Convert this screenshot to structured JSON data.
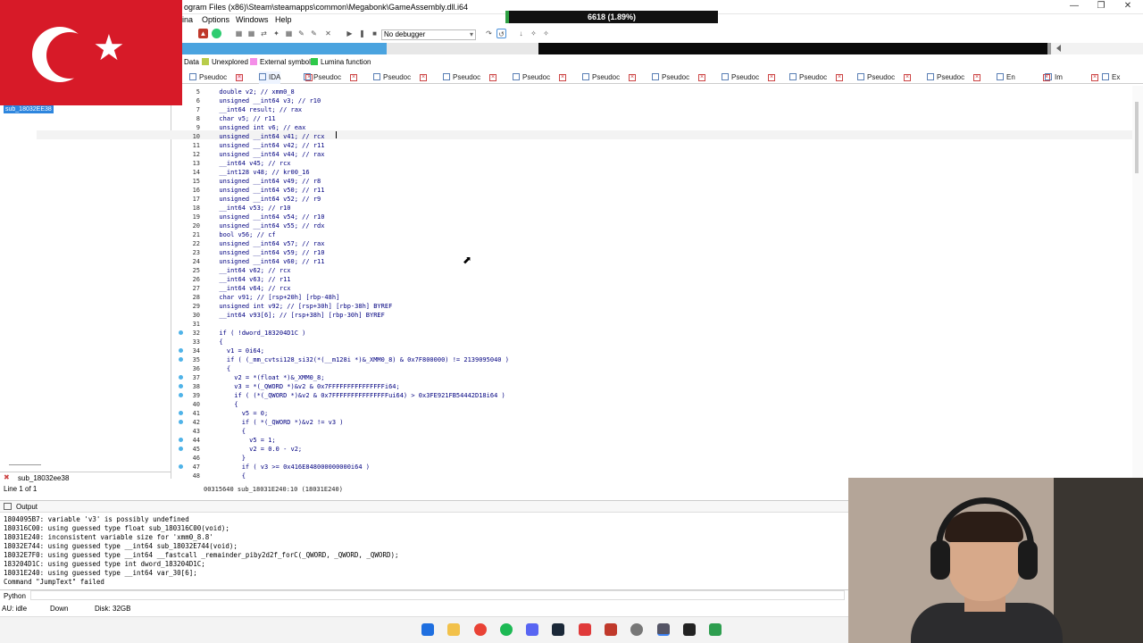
{
  "window": {
    "title": "ogram Files (x86)\\Steam\\steamapps\\common\\Megabonk\\GameAssembly.dll.i64",
    "progress_text": "6618 (1.89%)",
    "progress_fraction": 0.0189
  },
  "menu": [
    "ina",
    "Options",
    "Windows",
    "Help"
  ],
  "toolbar": {
    "debugger": "No debugger"
  },
  "legend": {
    "data": "Data",
    "unexplored": "Unexplored",
    "external": "External symbol",
    "lumina": "Lumina function",
    "colors": {
      "data": "#c8c8c8",
      "unexplored": "#b8cc4a",
      "external": "#f48ee8",
      "lumina": "#2ec94a"
    }
  },
  "tabs": [
    {
      "label": "Pseudoc",
      "close": true
    },
    {
      "label": "IDA",
      "close": false
    },
    {
      "label": "Pseudoc",
      "close": false
    },
    {
      "label": "Pseudoc",
      "close": false
    },
    {
      "label": "Pseudoc",
      "close": false
    },
    {
      "label": "Pseudoc",
      "close": false
    },
    {
      "label": "Pseudoc",
      "close": false
    },
    {
      "label": "Pseudoc",
      "close": false
    },
    {
      "label": "Pseudoc",
      "close": false
    },
    {
      "label": "Pseudoc",
      "close": false
    },
    {
      "label": "Pseudoc",
      "close": false
    },
    {
      "label": "Pseudoc",
      "close": false
    },
    {
      "label": "En",
      "close": false
    },
    {
      "label": "Im",
      "close": false
    },
    {
      "label": "Ex",
      "close": false
    }
  ],
  "functions": {
    "selected": "sub_18032EE38",
    "search_value": "sub_18032ee38",
    "line_info": "Line 1 of 1"
  },
  "code": {
    "lines": [
      {
        "n": "5",
        "t": "  double v2; // xmm0_8",
        "bp": false
      },
      {
        "n": "6",
        "t": "  unsigned __int64 v3; // r10",
        "bp": false
      },
      {
        "n": "7",
        "t": "  __int64 result; // rax",
        "bp": false
      },
      {
        "n": "8",
        "t": "  char v5; // r11",
        "bp": false
      },
      {
        "n": "9",
        "t": "  unsigned int v6; // eax",
        "bp": false
      },
      {
        "n": "10",
        "t": "  unsigned __int64 v41; // rcx",
        "bp": false
      },
      {
        "n": "11",
        "t": "  unsigned __int64 v42; // r11",
        "bp": false
      },
      {
        "n": "12",
        "t": "  unsigned __int64 v44; // rax",
        "bp": false
      },
      {
        "n": "13",
        "t": "  __int64 v45; // rcx",
        "bp": false
      },
      {
        "n": "14",
        "t": "  __int128 v48; // kr00_16",
        "bp": false
      },
      {
        "n": "15",
        "t": "  unsigned __int64 v49; // r8",
        "bp": false
      },
      {
        "n": "16",
        "t": "  unsigned __int64 v50; // r11",
        "bp": false
      },
      {
        "n": "17",
        "t": "  unsigned __int64 v52; // r9",
        "bp": false
      },
      {
        "n": "18",
        "t": "  __int64 v53; // r10",
        "bp": false
      },
      {
        "n": "19",
        "t": "  unsigned __int64 v54; // r10",
        "bp": false
      },
      {
        "n": "20",
        "t": "  unsigned __int64 v55; // rdx",
        "bp": false
      },
      {
        "n": "21",
        "t": "  bool v56; // cf",
        "bp": false
      },
      {
        "n": "22",
        "t": "  unsigned __int64 v57; // rax",
        "bp": false
      },
      {
        "n": "23",
        "t": "  unsigned __int64 v59; // r10",
        "bp": false
      },
      {
        "n": "24",
        "t": "  unsigned __int64 v60; // r11",
        "bp": false
      },
      {
        "n": "25",
        "t": "  __int64 v62; // rcx",
        "bp": false
      },
      {
        "n": "26",
        "t": "  __int64 v63; // r11",
        "bp": false
      },
      {
        "n": "27",
        "t": "  __int64 v64; // rcx",
        "bp": false
      },
      {
        "n": "28",
        "t": "  char v91; // [rsp+20h] [rbp-48h]",
        "bp": false
      },
      {
        "n": "29",
        "t": "  unsigned int v92; // [rsp+30h] [rbp-38h] BYREF",
        "bp": false
      },
      {
        "n": "30",
        "t": "  __int64 v93[6]; // [rsp+38h] [rbp-30h] BYREF",
        "bp": false
      },
      {
        "n": "31",
        "t": "",
        "bp": false
      },
      {
        "n": "32",
        "t": "  if ( !dword_183204D1C )",
        "bp": true
      },
      {
        "n": "33",
        "t": "  {",
        "bp": false
      },
      {
        "n": "34",
        "t": "    v1 = 0i64;",
        "bp": true
      },
      {
        "n": "35",
        "t": "    if ( (_mm_cvtsi128_si32(*(__m128i *)&_XMM0_8) & 0x7F800000) != 2139095040 )",
        "bp": true
      },
      {
        "n": "36",
        "t": "    {",
        "bp": false
      },
      {
        "n": "37",
        "t": "      v2 = *(float *)&_XMM0_8;",
        "bp": true
      },
      {
        "n": "38",
        "t": "      v3 = *(_QWORD *)&v2 & 0x7FFFFFFFFFFFFFFFi64;",
        "bp": true
      },
      {
        "n": "39",
        "t": "      if ( (*(_QWORD *)&v2 & 0x7FFFFFFFFFFFFFFFui64) > 0x3FE921FB54442D18i64 )",
        "bp": true
      },
      {
        "n": "40",
        "t": "      {",
        "bp": false
      },
      {
        "n": "41",
        "t": "        v5 = 0;",
        "bp": true
      },
      {
        "n": "42",
        "t": "        if ( *(_QWORD *)&v2 != v3 )",
        "bp": true
      },
      {
        "n": "43",
        "t": "        {",
        "bp": false
      },
      {
        "n": "44",
        "t": "          v5 = 1;",
        "bp": true
      },
      {
        "n": "45",
        "t": "          v2 = 0.0 - v2;",
        "bp": true
      },
      {
        "n": "46",
        "t": "        }",
        "bp": false
      },
      {
        "n": "47",
        "t": "        if ( v3 >= 0x416E848000000000i64 )",
        "bp": true
      },
      {
        "n": "48",
        "t": "        {",
        "bp": false
      }
    ],
    "address": "00315640 sub_18031E240:10 (18031E240)"
  },
  "output": {
    "title": "Output",
    "lines": [
      "1804095B7: variable 'v3' is possibly undefined",
      "180316C00: using guessed type float sub_180316C00(void);",
      "18031E240: inconsistent variable size for 'xmm0_8.8'",
      "18032E744: using guessed type __int64 sub_18032E744(void);",
      "18032E7F0: using guessed type __int64 __fastcall _remainder_piby2d2f_forC(_QWORD, _QWORD, _QWORD);",
      "183204D1C: using guessed type int dword_183204D1C;",
      "18031E240: using guessed type __int64 var_30[6];",
      "Command \"JumpText\" failed"
    ],
    "python_label": "Python"
  },
  "status": {
    "au": "AU:  idle",
    "dir": "Down",
    "disk": "Disk: 32GB"
  }
}
